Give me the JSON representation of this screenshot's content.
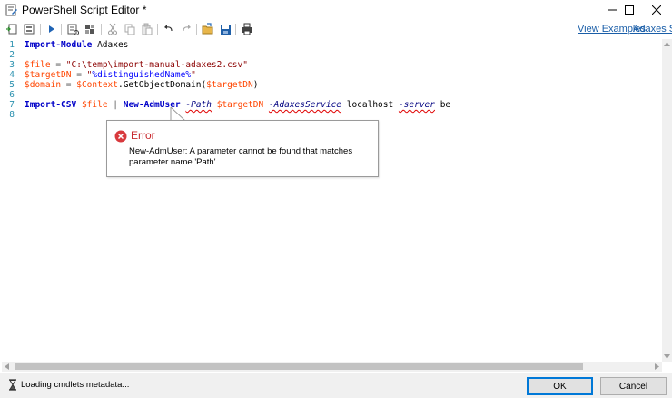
{
  "window": {
    "title": "PowerShell Script Editor *",
    "minimize_icon": "minimize-icon",
    "maximize_icon": "maximize-icon",
    "close_icon": "close-icon"
  },
  "toolbar": {
    "links": {
      "view_examples": "View Examples",
      "adaxes_sdk": "Adaxes SDK"
    },
    "icons": [
      "insert-icon",
      "insert-template-icon",
      "run-icon",
      "check-syntax-icon",
      "select-object-icon",
      "cut-icon",
      "copy-icon",
      "paste-icon",
      "undo-icon",
      "redo-icon",
      "open-icon",
      "save-icon",
      "print-icon"
    ]
  },
  "editor": {
    "line_numbers": [
      "1",
      "2",
      "3",
      "4",
      "5",
      "6",
      "7",
      "8"
    ],
    "lines": {
      "l1": {
        "kw": "Import-Module",
        "arg": " Adaxes"
      },
      "l3": {
        "var": "$file",
        "eq": " = ",
        "str": "\"C:\\temp\\import-manual-adaxes2.csv\""
      },
      "l4": {
        "var": "$targetDN",
        "eq": " = ",
        "q1": "\"",
        "strvar": "%distinguishedName%",
        "q2": "\""
      },
      "l5": {
        "var": "$domain",
        "eq": " = ",
        "ctx": "$Context",
        "method": ".GetObjectDomain(",
        "arg": "$targetDN",
        "close": ")"
      },
      "l7": {
        "kw": "Import-CSV",
        "sp1": " ",
        "v1": "$file",
        "pipe": " | ",
        "cmd": "New-AdmUser",
        "sp2": " ",
        "p1": "-Path",
        "sp3": " ",
        "v2": "$targetDN",
        "sp4": " ",
        "p2": "-AdaxesService",
        "val": " localhost ",
        "p3": "-server",
        "rest": " be"
      }
    }
  },
  "error_tooltip": {
    "title": "Error",
    "message": "New-AdmUser: A parameter cannot be found that matches parameter name 'Path'."
  },
  "status": {
    "text": "Loading cmdlets metadata...",
    "icon": "hourglass-icon"
  },
  "buttons": {
    "ok": "OK",
    "cancel": "Cancel"
  },
  "colors": {
    "keyword": "#0000c8",
    "variable": "#ff4500",
    "string": "#8b0000",
    "line_number": "#2b91af",
    "link": "#1a5ea8",
    "error": "#c8282d"
  }
}
